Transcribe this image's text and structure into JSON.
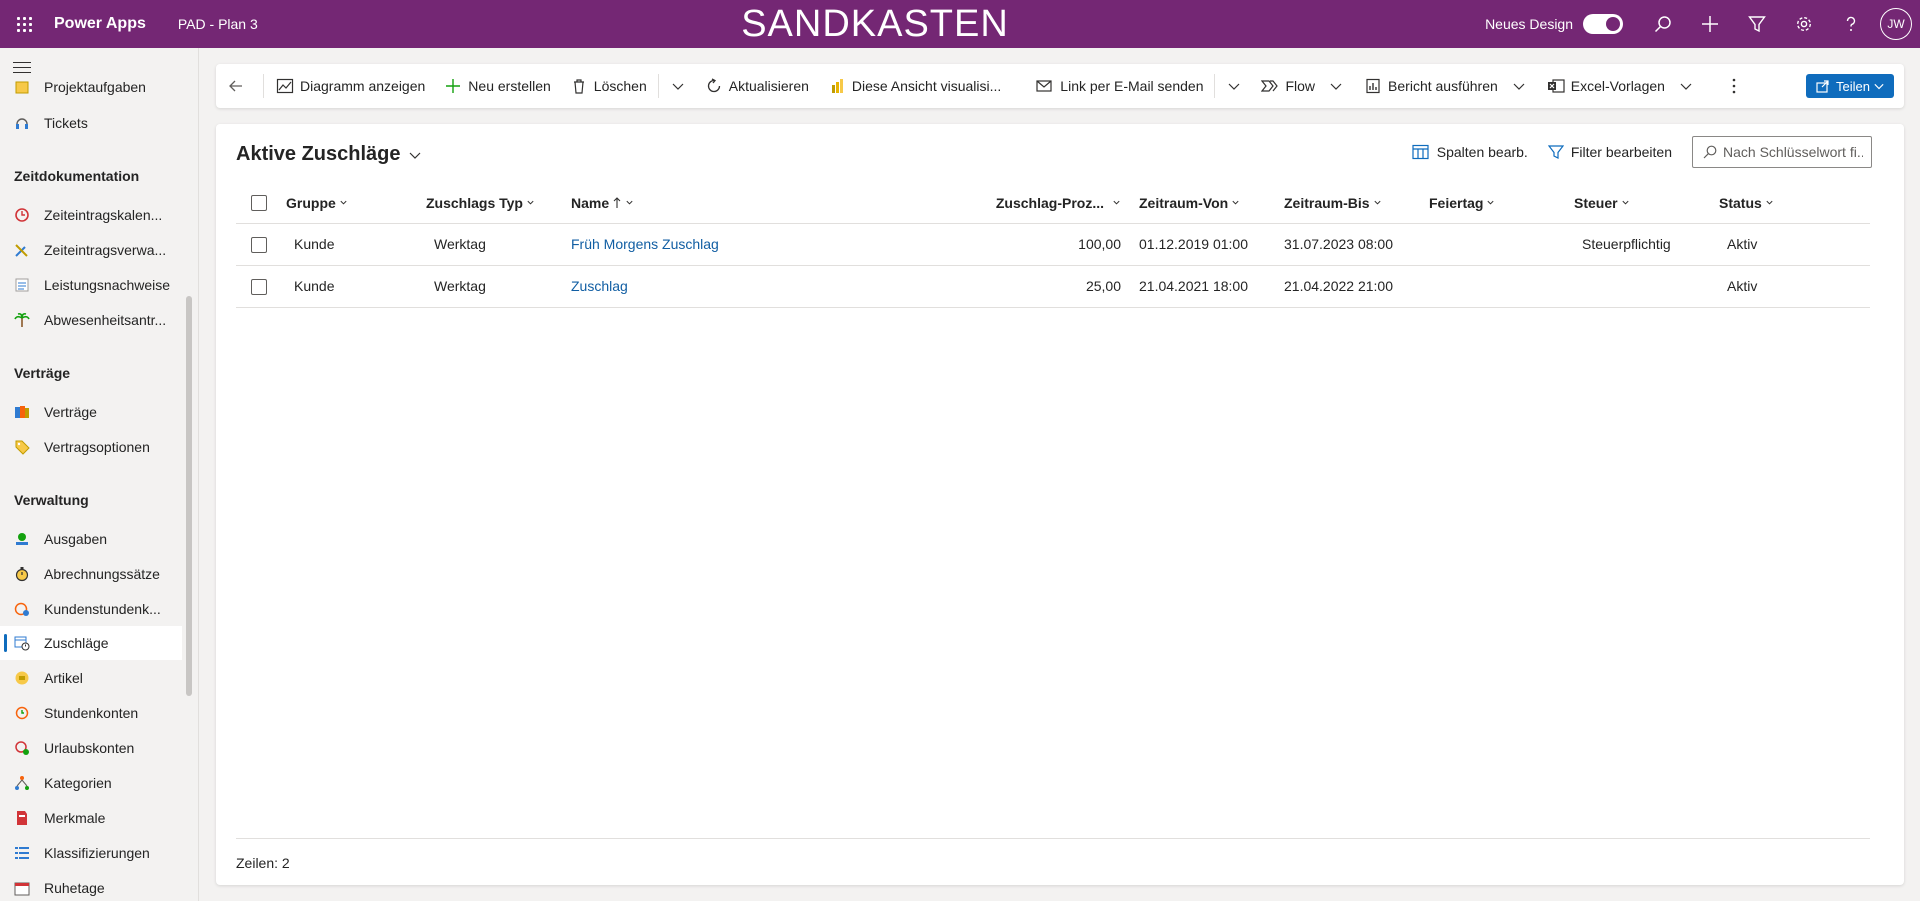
{
  "topbar": {
    "app_name": "Power Apps",
    "environment": "PAD - Plan 3",
    "banner": "SANDKASTEN",
    "new_design_label": "Neues Design",
    "avatar_initials": "JW",
    "colors": {
      "background": "#742774",
      "text": "#ffffff"
    }
  },
  "sidebar": {
    "items_top": [
      {
        "label": "Projektaufgaben",
        "icon": "task-icon"
      },
      {
        "label": "Tickets",
        "icon": "ticket-icon"
      }
    ],
    "groups": [
      {
        "title": "Zeitdokumentation",
        "items": [
          {
            "label": "Zeiteintragskalen...",
            "icon": "clock-icon"
          },
          {
            "label": "Zeiteintragsverwa...",
            "icon": "tools-icon"
          },
          {
            "label": "Leistungsnachweise",
            "icon": "list-icon"
          },
          {
            "label": "Abwesenheitsantr...",
            "icon": "palm-tree-icon"
          }
        ]
      },
      {
        "title": "Verträge",
        "items": [
          {
            "label": "Verträge",
            "icon": "contract-icon"
          },
          {
            "label": "Vertragsoptionen",
            "icon": "tag-icon"
          }
        ]
      },
      {
        "title": "Verwaltung",
        "items": [
          {
            "label": "Ausgaben",
            "icon": "expense-icon"
          },
          {
            "label": "Abrechnungssätze",
            "icon": "stopwatch-icon"
          },
          {
            "label": "Kundenstundenk...",
            "icon": "customer-hours-icon"
          },
          {
            "label": "Zuschläge",
            "icon": "surcharge-icon",
            "active": true
          },
          {
            "label": "Artikel",
            "icon": "article-icon"
          },
          {
            "label": "Stundenkonten",
            "icon": "hour-account-icon"
          },
          {
            "label": "Urlaubskonten",
            "icon": "vacation-account-icon"
          },
          {
            "label": "Kategorien",
            "icon": "category-icon"
          },
          {
            "label": "Merkmale",
            "icon": "feature-icon"
          },
          {
            "label": "Klassifizierungen",
            "icon": "classification-icon"
          },
          {
            "label": "Ruhetage",
            "icon": "calendar-icon"
          }
        ]
      }
    ]
  },
  "commandbar": {
    "show_chart": "Diagramm anzeigen",
    "new": "Neu erstellen",
    "delete": "Löschen",
    "refresh": "Aktualisieren",
    "visualize": "Diese Ansicht visualisi...",
    "email_link": "Link per E-Mail senden",
    "flow": "Flow",
    "run_report": "Bericht ausführen",
    "excel_templates": "Excel-Vorlagen",
    "share": "Teilen"
  },
  "view": {
    "title": "Aktive Zuschläge",
    "edit_columns": "Spalten bearb.",
    "edit_filters": "Filter bearbeiten",
    "search_placeholder": "Nach Schlüsselwort fi...",
    "columns": {
      "gruppe": "Gruppe",
      "typ": "Zuschlags Typ",
      "name": "Name",
      "prozent": "Zuschlag-Proz...",
      "von": "Zeitraum-Von",
      "bis": "Zeitraum-Bis",
      "feiertag": "Feiertag",
      "steuer": "Steuer",
      "status": "Status"
    },
    "rows": [
      {
        "gruppe": "Kunde",
        "typ": "Werktag",
        "name": "Früh Morgens Zuschlag",
        "prozent": "100,00",
        "von": "01.12.2019 01:00",
        "bis": "31.07.2023 08:00",
        "feiertag": "",
        "steuer": "Steuerpflichtig",
        "status": "Aktiv"
      },
      {
        "gruppe": "Kunde",
        "typ": "Werktag",
        "name": "Zuschlag",
        "prozent": "25,00",
        "von": "21.04.2021 18:00",
        "bis": "21.04.2022 21:00",
        "feiertag": "",
        "steuer": "",
        "status": "Aktiv"
      }
    ],
    "row_count_label": "Zeilen: 2"
  }
}
